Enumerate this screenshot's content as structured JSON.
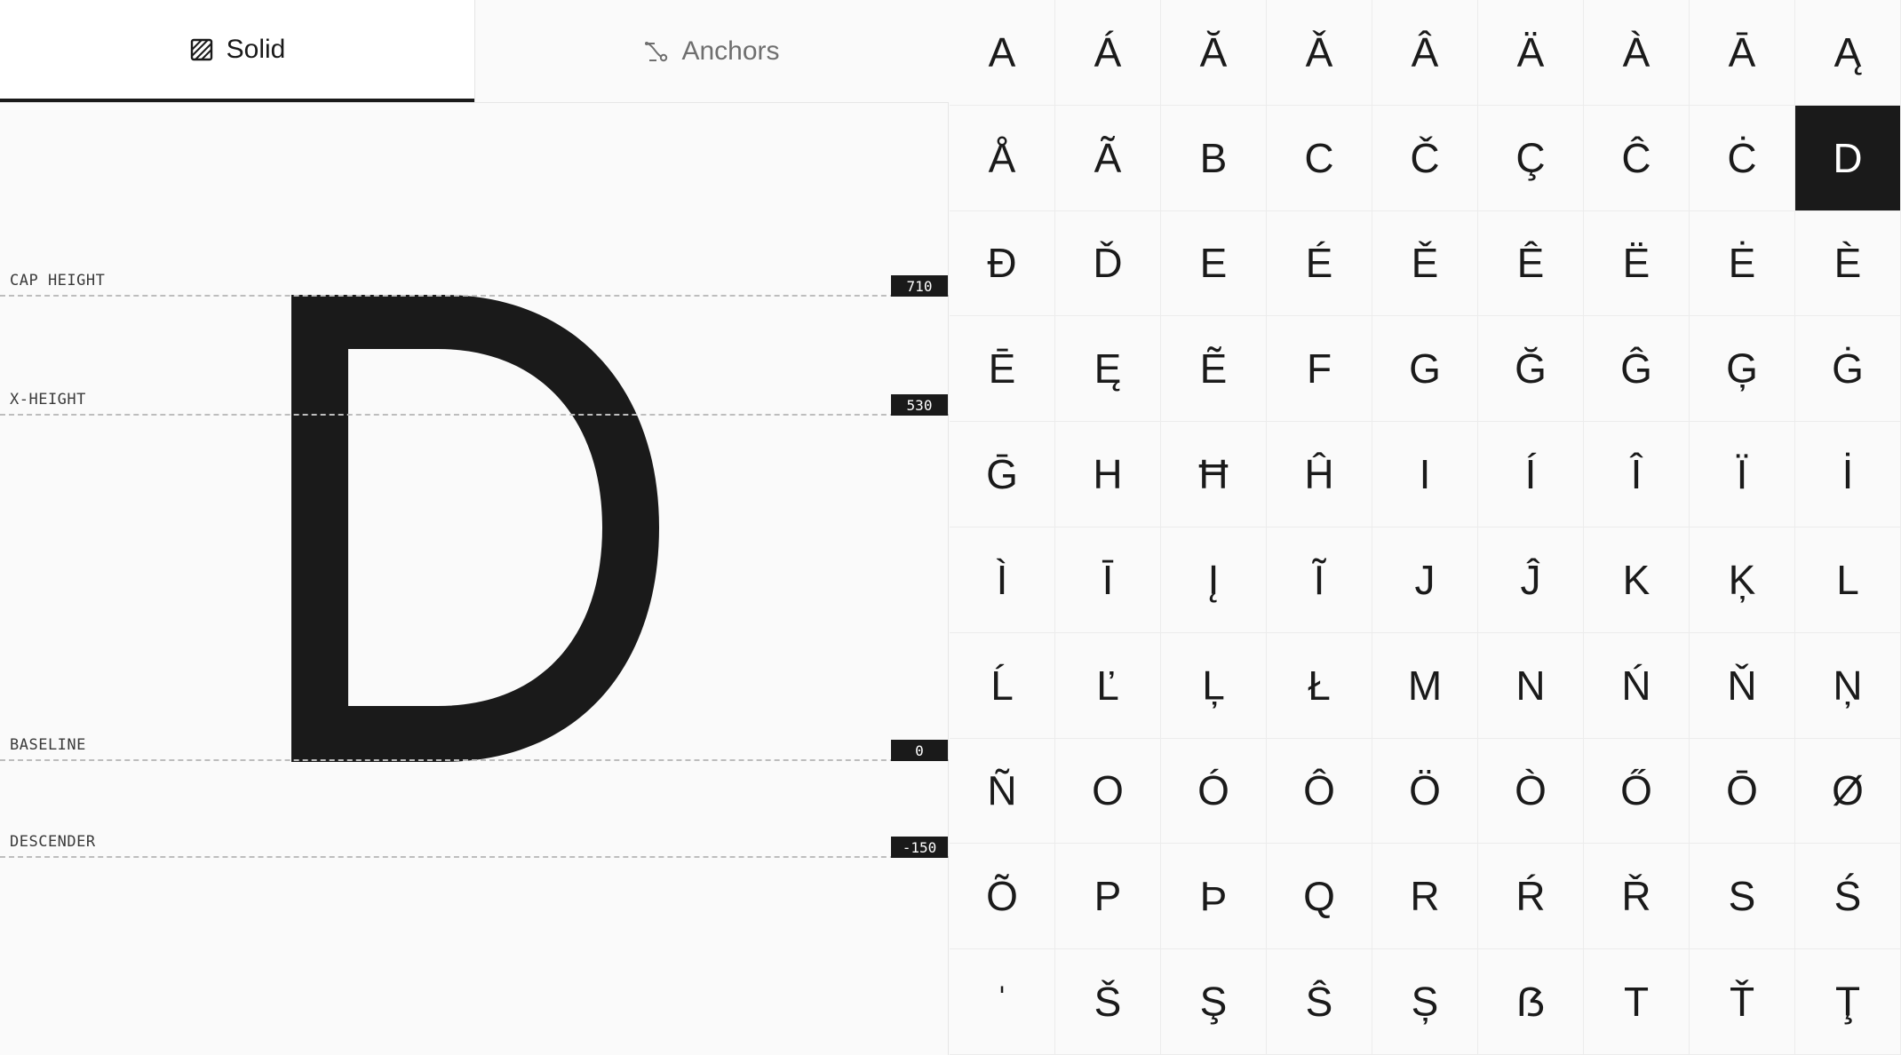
{
  "tabs": [
    {
      "label": "Solid",
      "icon": "hatched-square-icon",
      "active": true
    },
    {
      "label": "Anchors",
      "icon": "anchor-curve-icon",
      "active": false
    }
  ],
  "preview": {
    "glyph": "D",
    "metrics": [
      {
        "key": "cap_height",
        "label": "CAP HEIGHT",
        "value": "710"
      },
      {
        "key": "x_height",
        "label": "X-HEIGHT",
        "value": "530"
      },
      {
        "key": "baseline",
        "label": "BASELINE",
        "value": "0"
      },
      {
        "key": "descender",
        "label": "DESCENDER",
        "value": "-150"
      }
    ]
  },
  "glyph_grid": {
    "selected": "D",
    "glyphs": [
      "A",
      "Á",
      "Ă",
      "Ǎ",
      "Â",
      "Ä",
      "À",
      "Ā",
      "Ą",
      "Å",
      "Ã",
      "B",
      "C",
      "Č",
      "Ç",
      "Ĉ",
      "Ċ",
      "D",
      "Đ",
      "Ď",
      "E",
      "É",
      "Ě",
      "Ê",
      "Ë",
      "Ė",
      "È",
      "Ē",
      "Ę",
      "Ẽ",
      "F",
      "G",
      "Ğ",
      "Ĝ",
      "Ģ",
      "Ġ",
      "Ḡ",
      "H",
      "Ħ",
      "Ĥ",
      "I",
      "Í",
      "Î",
      "Ï",
      "İ",
      "Ì",
      "Ī",
      "Į",
      "Ĩ",
      "J",
      "Ĵ",
      "K",
      "Ķ",
      "L",
      "Ĺ",
      "Ľ",
      "Ļ",
      "Ł",
      "M",
      "N",
      "Ń",
      "Ň",
      "Ņ",
      "Ñ",
      "O",
      "Ó",
      "Ô",
      "Ö",
      "Ò",
      "Ő",
      "Ō",
      "Ø",
      "Õ",
      "P",
      "Þ",
      "Q",
      "R",
      "Ŕ",
      "Ř",
      "S",
      "Ś",
      "ˈ",
      "Š",
      "Ş",
      "Ŝ",
      "Ș",
      "ẞ",
      "T",
      "Ť",
      "Ţ"
    ]
  }
}
